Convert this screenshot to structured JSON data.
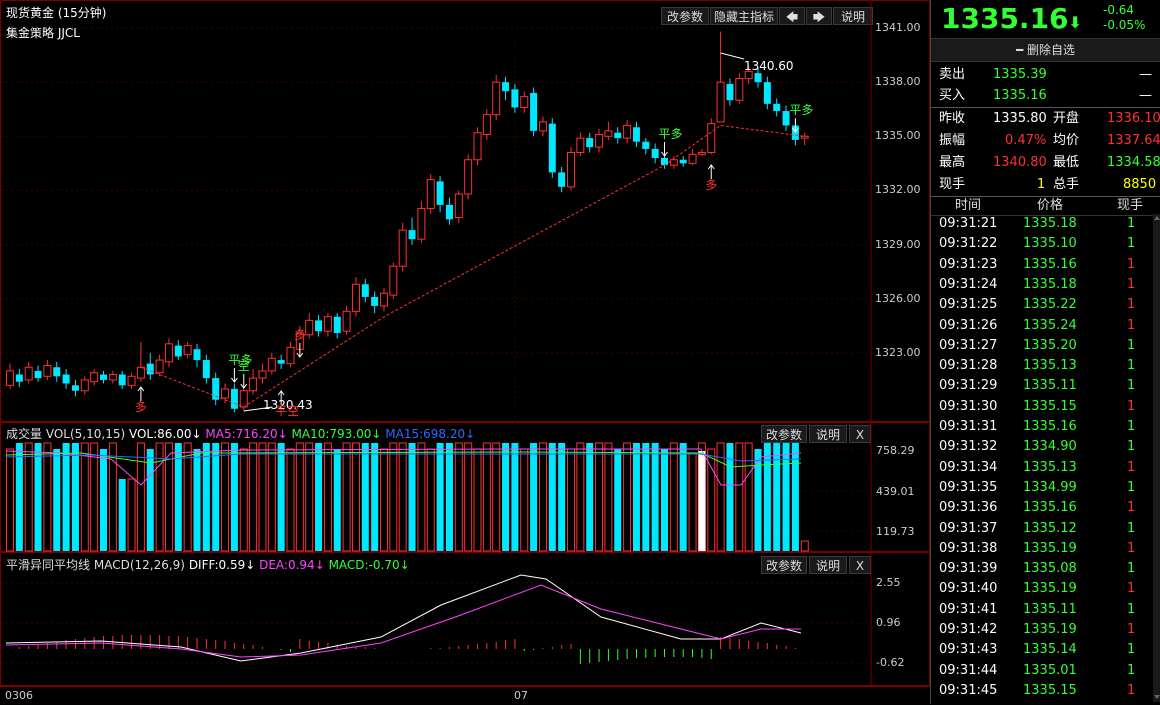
{
  "chart_title": "现货黄金 (15分钟)",
  "strategy": "集金策略 JJCL",
  "toolbar": {
    "params": "改参数",
    "hide": "隐藏主指标",
    "left": "🡄",
    "right": "🡆",
    "help": "说明"
  },
  "price_axis": [
    "1341.00",
    "1338.00",
    "1335.00",
    "1332.00",
    "1329.00",
    "1326.00",
    "1323.00"
  ],
  "annotations": {
    "high": "1340.60",
    "low": "1320.43",
    "duo": "多",
    "pingduo": "平多",
    "kong": "空",
    "pingkong": "平空"
  },
  "vol": {
    "name": "成交量",
    "label": "VOL(5,10,15)",
    "vol": "VOL:86.00↓",
    "ma5": "MA5:716.20↓",
    "ma10": "MA10:793.00↓",
    "ma15": "MA15:698.20↓",
    "params": "改参数",
    "help": "说明",
    "close": "X",
    "axis": [
      "758.29",
      "439.01",
      "119.73"
    ]
  },
  "macd": {
    "name": "平滑异同平均线",
    "label": "MACD(12,26,9)",
    "diff": "DIFF:0.59↓",
    "dea": "DEA:0.94↓",
    "macd": "MACD:-0.70↓",
    "params": "改参数",
    "help": "说明",
    "close": "X",
    "axis": [
      "2.55",
      "0.96",
      "-0.62"
    ]
  },
  "x_labels": [
    "0306",
    "07"
  ],
  "quote": {
    "price": "1335.16",
    "arrow": "⬇",
    "change": "-0.64",
    "pct": "-0.05%",
    "watch": "━ 删除自选",
    "sell_label": "卖出",
    "sell": "1335.39",
    "sell_vol": "—",
    "buy_label": "买入",
    "buy": "1335.16",
    "buy_vol": "—",
    "prev_label": "昨收",
    "prev": "1335.80",
    "open_label": "开盘",
    "open": "1336.10",
    "amp_label": "振幅",
    "amp": "0.47%",
    "avg_label": "均价",
    "avg": "1337.64",
    "high_label": "最高",
    "high": "1340.80",
    "low_label": "最低",
    "low": "1334.58",
    "cur_label": "现手",
    "cur": "1",
    "total_label": "总手",
    "total": "8850"
  },
  "ticks_header": [
    "时间",
    "价格",
    "现手"
  ],
  "ticks": [
    {
      "t": "09:31:21",
      "p": "1335.18",
      "v": "1",
      "c": "g"
    },
    {
      "t": "09:31:22",
      "p": "1335.10",
      "v": "1",
      "c": "g"
    },
    {
      "t": "09:31:23",
      "p": "1335.16",
      "v": "1",
      "c": "r"
    },
    {
      "t": "09:31:24",
      "p": "1335.18",
      "v": "1",
      "c": "r"
    },
    {
      "t": "09:31:25",
      "p": "1335.22",
      "v": "1",
      "c": "r"
    },
    {
      "t": "09:31:26",
      "p": "1335.24",
      "v": "1",
      "c": "r"
    },
    {
      "t": "09:31:27",
      "p": "1335.20",
      "v": "1",
      "c": "g"
    },
    {
      "t": "09:31:28",
      "p": "1335.13",
      "v": "1",
      "c": "g"
    },
    {
      "t": "09:31:29",
      "p": "1335.11",
      "v": "1",
      "c": "g"
    },
    {
      "t": "09:31:30",
      "p": "1335.15",
      "v": "1",
      "c": "r"
    },
    {
      "t": "09:31:31",
      "p": "1335.16",
      "v": "1",
      "c": "g"
    },
    {
      "t": "09:31:32",
      "p": "1334.90",
      "v": "1",
      "c": "g"
    },
    {
      "t": "09:31:34",
      "p": "1335.13",
      "v": "1",
      "c": "r"
    },
    {
      "t": "09:31:35",
      "p": "1334.99",
      "v": "1",
      "c": "g"
    },
    {
      "t": "09:31:36",
      "p": "1335.16",
      "v": "1",
      "c": "r"
    },
    {
      "t": "09:31:37",
      "p": "1335.12",
      "v": "1",
      "c": "g"
    },
    {
      "t": "09:31:38",
      "p": "1335.19",
      "v": "1",
      "c": "r"
    },
    {
      "t": "09:31:39",
      "p": "1335.08",
      "v": "1",
      "c": "g"
    },
    {
      "t": "09:31:40",
      "p": "1335.19",
      "v": "1",
      "c": "r"
    },
    {
      "t": "09:31:41",
      "p": "1335.11",
      "v": "1",
      "c": "g"
    },
    {
      "t": "09:31:42",
      "p": "1335.19",
      "v": "1",
      "c": "r"
    },
    {
      "t": "09:31:43",
      "p": "1335.14",
      "v": "1",
      "c": "g"
    },
    {
      "t": "09:31:44",
      "p": "1335.01",
      "v": "1",
      "c": "g"
    },
    {
      "t": "09:31:45",
      "p": "1335.15",
      "v": "1",
      "c": "r"
    }
  ],
  "candles": [
    [
      1321.2,
      1322.0,
      1322.4,
      1321.0
    ],
    [
      1321.8,
      1321.4,
      1322.1,
      1321.1
    ],
    [
      1321.5,
      1322.2,
      1322.5,
      1321.3
    ],
    [
      1322.0,
      1321.6,
      1322.3,
      1321.4
    ],
    [
      1321.7,
      1322.3,
      1322.6,
      1321.5
    ],
    [
      1322.2,
      1321.7,
      1322.5,
      1321.4
    ],
    [
      1321.8,
      1321.3,
      1322.1,
      1321.0
    ],
    [
      1321.2,
      1320.9,
      1321.5,
      1320.6
    ],
    [
      1320.9,
      1321.5,
      1321.7,
      1320.7
    ],
    [
      1321.4,
      1321.9,
      1322.1,
      1321.2
    ],
    [
      1321.8,
      1321.5,
      1322.0,
      1321.3
    ],
    [
      1321.5,
      1321.8,
      1322.0,
      1321.3
    ],
    [
      1321.8,
      1321.2,
      1322.0,
      1321.0
    ],
    [
      1321.2,
      1321.7,
      1321.9,
      1321.0
    ],
    [
      1321.6,
      1322.2,
      1323.6,
      1321.4
    ],
    [
      1322.4,
      1321.8,
      1323.0,
      1321.5
    ],
    [
      1321.9,
      1322.6,
      1322.9,
      1321.7
    ],
    [
      1322.5,
      1323.5,
      1323.8,
      1322.2
    ],
    [
      1323.4,
      1322.8,
      1323.7,
      1322.6
    ],
    [
      1322.9,
      1323.4,
      1323.6,
      1322.7
    ],
    [
      1323.2,
      1322.6,
      1323.5,
      1322.2
    ],
    [
      1322.6,
      1321.6,
      1322.9,
      1321.3
    ],
    [
      1321.6,
      1320.4,
      1321.9,
      1320.1
    ],
    [
      1320.5,
      1321.0,
      1321.3,
      1320.2
    ],
    [
      1321.0,
      1319.9,
      1321.3,
      1319.7
    ],
    [
      1320.0,
      1320.9,
      1321.1,
      1319.8
    ],
    [
      1320.9,
      1321.6,
      1322.1,
      1320.7
    ],
    [
      1321.6,
      1322.0,
      1322.4,
      1321.3
    ],
    [
      1322.0,
      1322.7,
      1323.0,
      1321.8
    ],
    [
      1322.6,
      1322.4,
      1322.9,
      1322.1
    ],
    [
      1322.4,
      1323.3,
      1323.6,
      1322.2
    ],
    [
      1323.2,
      1324.1,
      1324.5,
      1323.0
    ],
    [
      1324.0,
      1324.8,
      1325.2,
      1323.8
    ],
    [
      1324.8,
      1324.2,
      1325.1,
      1323.9
    ],
    [
      1324.2,
      1325.0,
      1325.2,
      1323.9
    ],
    [
      1325.0,
      1324.1,
      1325.2,
      1323.8
    ],
    [
      1324.2,
      1325.3,
      1325.6,
      1324.0
    ],
    [
      1325.3,
      1326.8,
      1327.2,
      1325.0
    ],
    [
      1326.8,
      1326.1,
      1327.1,
      1325.8
    ],
    [
      1326.1,
      1325.6,
      1326.4,
      1325.2
    ],
    [
      1325.6,
      1326.3,
      1326.6,
      1325.3
    ],
    [
      1326.2,
      1327.8,
      1328.0,
      1326.0
    ],
    [
      1327.8,
      1329.8,
      1330.2,
      1327.5
    ],
    [
      1329.8,
      1329.3,
      1330.5,
      1329.0
    ],
    [
      1329.3,
      1331.0,
      1331.4,
      1329.1
    ],
    [
      1331.0,
      1332.6,
      1332.9,
      1330.7
    ],
    [
      1332.5,
      1331.2,
      1332.8,
      1330.8
    ],
    [
      1331.2,
      1330.4,
      1331.6,
      1330.1
    ],
    [
      1330.5,
      1331.8,
      1332.0,
      1330.2
    ],
    [
      1331.8,
      1333.7,
      1334.0,
      1331.5
    ],
    [
      1333.7,
      1335.2,
      1335.5,
      1333.4
    ],
    [
      1335.1,
      1336.2,
      1336.5,
      1334.8
    ],
    [
      1336.2,
      1338.0,
      1338.4,
      1335.9
    ],
    [
      1338.0,
      1337.5,
      1338.3,
      1337.0
    ],
    [
      1337.6,
      1336.6,
      1337.9,
      1336.3
    ],
    [
      1336.6,
      1337.2,
      1337.5,
      1336.3
    ],
    [
      1337.4,
      1335.3,
      1337.7,
      1335.0
    ],
    [
      1335.3,
      1335.8,
      1336.1,
      1335.0
    ],
    [
      1335.7,
      1333.0,
      1336.0,
      1332.7
    ],
    [
      1333.0,
      1332.2,
      1333.3,
      1331.9
    ],
    [
      1332.2,
      1334.1,
      1334.4,
      1332.0
    ],
    [
      1334.1,
      1334.9,
      1335.2,
      1333.9
    ],
    [
      1334.9,
      1334.4,
      1335.2,
      1334.1
    ],
    [
      1334.4,
      1335.1,
      1335.4,
      1334.1
    ],
    [
      1335.0,
      1335.3,
      1335.8,
      1334.8
    ],
    [
      1335.2,
      1334.9,
      1335.5,
      1334.6
    ],
    [
      1334.9,
      1335.6,
      1335.9,
      1334.6
    ],
    [
      1335.5,
      1334.7,
      1335.8,
      1334.4
    ],
    [
      1334.7,
      1334.3,
      1334.9,
      1334.0
    ],
    [
      1334.3,
      1333.8,
      1334.6,
      1333.5
    ],
    [
      1333.8,
      1333.4,
      1334.1,
      1333.2
    ],
    [
      1333.4,
      1333.7,
      1333.9,
      1333.2
    ],
    [
      1333.7,
      1333.5,
      1333.9,
      1333.3
    ],
    [
      1333.5,
      1334.0,
      1334.3,
      1333.4
    ],
    [
      1334.0,
      1334.1,
      1334.3,
      1333.9
    ],
    [
      1334.1,
      1335.7,
      1336.0,
      1334.0
    ],
    [
      1335.8,
      1338.0,
      1340.8,
      1337.6
    ],
    [
      1337.9,
      1337.0,
      1338.2,
      1336.7
    ],
    [
      1337.0,
      1338.2,
      1338.5,
      1336.8
    ],
    [
      1338.2,
      1338.6,
      1338.9,
      1337.9
    ],
    [
      1338.5,
      1338.0,
      1338.8,
      1337.7
    ],
    [
      1338.0,
      1336.8,
      1338.3,
      1336.5
    ],
    [
      1336.8,
      1336.4,
      1337.1,
      1336.1
    ],
    [
      1336.4,
      1335.6,
      1336.7,
      1335.3
    ],
    [
      1335.6,
      1334.8,
      1335.9,
      1334.5
    ],
    [
      1334.9,
      1335.0,
      1335.2,
      1334.5
    ]
  ]
}
